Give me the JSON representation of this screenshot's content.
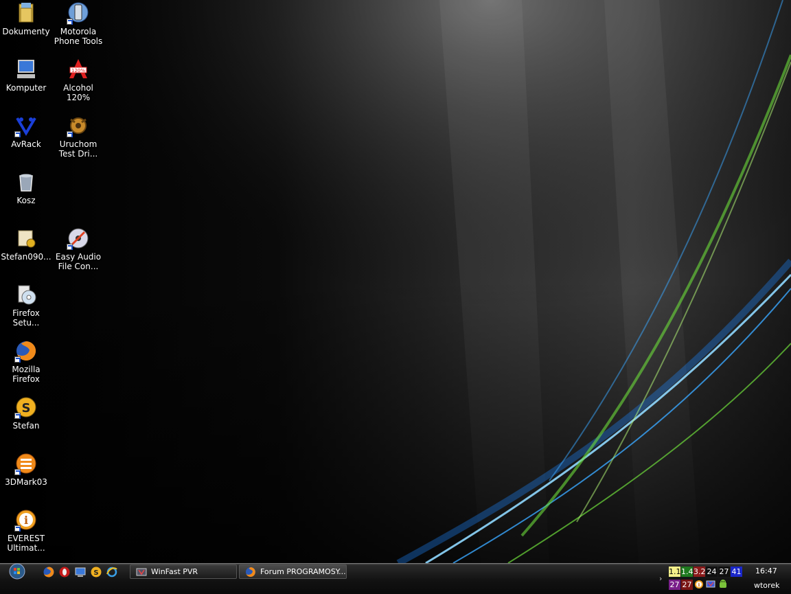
{
  "desktop": {
    "icons": [
      {
        "label": "Dokumenty",
        "icon": "documents-folder-icon"
      },
      {
        "label": "Motorola\nPhone Tools",
        "icon": "motorola-phone-icon"
      },
      {
        "label": "Komputer",
        "icon": "computer-icon"
      },
      {
        "label": "Alcohol\n120%",
        "icon": "alcohol-120-icon"
      },
      {
        "label": "AvRack",
        "icon": "avrack-icon"
      },
      {
        "label": "Uruchom\nTest Dri...",
        "icon": "test-drive-icon"
      },
      {
        "label": "Kosz",
        "icon": "recycle-bin-icon"
      },
      {
        "label": "Stefan090...",
        "icon": "installer-package-icon"
      },
      {
        "label": "Easy Audio\nFile Con...",
        "icon": "audio-converter-icon"
      },
      {
        "label": "Firefox\nSetu...",
        "icon": "setup-cd-icon"
      },
      {
        "label": "Mozilla\nFirefox",
        "icon": "firefox-icon"
      },
      {
        "label": "Stefan",
        "icon": "stefan-app-icon"
      },
      {
        "label": "3DMark03",
        "icon": "3dmark-icon"
      },
      {
        "label": "EVEREST\nUltimat...",
        "icon": "everest-info-icon"
      }
    ]
  },
  "taskbar": {
    "start_icon": "windows-orb-icon",
    "quick_launch": [
      "firefox-icon",
      "opera-icon",
      "show-desktop-icon",
      "stefan-app-icon",
      "internet-explorer-icon"
    ],
    "tasks": [
      {
        "label": "WinFast PVR",
        "icon": "winfast-pvr-icon"
      },
      {
        "label": "Forum PROGRAMOSY....",
        "icon": "firefox-icon"
      }
    ],
    "tray": {
      "top_row": [
        {
          "value": "1.1",
          "bg": "#f5f08a",
          "fg": "#000000"
        },
        {
          "value": "1.4",
          "bg": "#1f7a1f",
          "fg": "#ffffff"
        },
        {
          "value": "3.2",
          "bg": "#8a1b1b",
          "fg": "#ffffff"
        },
        {
          "value": "24",
          "bg": "#101010",
          "fg": "#ffffff"
        },
        {
          "value": "27",
          "bg": "#101010",
          "fg": "#ffffff"
        },
        {
          "value": "41",
          "bg": "#1a27c9",
          "fg": "#ffffff"
        }
      ],
      "bottom_row": [
        {
          "value": "27",
          "bg": "#7a1f8a",
          "fg": "#ffffff"
        },
        {
          "value": "27",
          "bg": "#7a1414",
          "fg": "#ffffff"
        }
      ],
      "bottom_icons": [
        "everest-info-icon",
        "network-icon",
        "android-icon"
      ],
      "clock": "16:47",
      "day": "wtorek"
    }
  },
  "colors": {
    "wallpaper_dark": "#050505",
    "streak_green": "#6ddc3a",
    "streak_blue": "#3aa8ff"
  }
}
